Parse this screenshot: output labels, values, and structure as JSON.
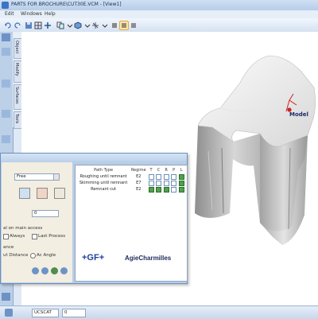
{
  "window": {
    "title": "PARTS FOR BROCHURE\\CUT30E.VCM - [View1]"
  },
  "menu": [
    "Edit",
    "Windows",
    "Help"
  ],
  "toolbar": {
    "icons": [
      "undo-icon",
      "redo-icon",
      "save-icon",
      "grid-icon",
      "plus-icon",
      "cube-icon",
      "arrow-icon",
      "copy-icon",
      "layers-icon",
      "view-icon",
      "separator",
      "shade-icon",
      "list-icon",
      "menu-icon"
    ],
    "active_index": 12
  },
  "side_tabs": [
    "Object",
    "Modify",
    "Surfaces",
    "Tools"
  ],
  "viewport": {
    "model_label": "Model",
    "colors": {
      "background": "#ffffff",
      "part_light": "#f4f4f4",
      "part_dark": "#9a9a9a",
      "axis": "#cc2222"
    }
  },
  "dialog": {
    "mode_value": "Free",
    "numeric_value": "0",
    "text_lines": [
      "al on main access",
      "Always",
      "Last Process",
      "ance",
      "ut Distance",
      "Ac Angle"
    ],
    "table": {
      "headers": [
        "Path Type",
        "Regime",
        "T",
        "C",
        "R",
        "P",
        "L"
      ],
      "rows": [
        {
          "path_type": "Roughing until remnant",
          "regime": "E2",
          "checks": [
            false,
            false,
            false,
            false,
            true
          ]
        },
        {
          "path_type": "Skimming until remnant",
          "regime": "E7",
          "checks": [
            false,
            false,
            false,
            false,
            true
          ]
        },
        {
          "path_type": "Remnant cut",
          "regime": "E2",
          "checks": [
            true,
            true,
            true,
            false,
            true
          ]
        }
      ]
    },
    "logo_gf": "+GF+",
    "logo_agie": "AgieCharmilles"
  },
  "statusbar": {
    "ucs": "UCSCAT",
    "value": "0"
  }
}
